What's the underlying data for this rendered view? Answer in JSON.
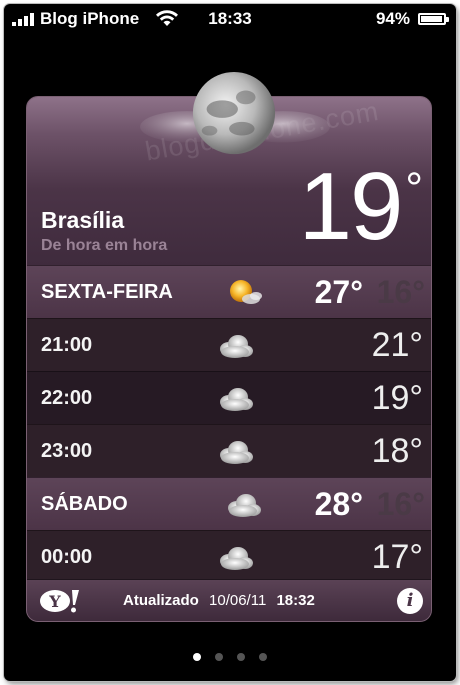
{
  "status_bar": {
    "carrier": "Blog iPhone",
    "time": "18:33",
    "battery": "94%",
    "battery_level": 0.94
  },
  "weather": {
    "watermark": "blogdoiphone.com",
    "city": "Brasília",
    "subtitle": "De hora em hora",
    "current_temp": "19",
    "degree_symbol": "°",
    "rows": [
      {
        "type": "day",
        "label": "SEXTA-FEIRA",
        "icon": "sun-cloud-icon",
        "high": "27°",
        "low": "16°"
      },
      {
        "type": "hour",
        "label": "21:00",
        "icon": "moon-cloud-icon",
        "temp": "21°"
      },
      {
        "type": "hour",
        "label": "22:00",
        "icon": "moon-cloud-icon",
        "temp": "19°"
      },
      {
        "type": "hour",
        "label": "23:00",
        "icon": "moon-cloud-icon",
        "temp": "18°"
      },
      {
        "type": "day",
        "label": "SÁBADO",
        "icon": "moon-cloud-icon",
        "high": "28°",
        "low": "16°"
      },
      {
        "type": "hour",
        "label": "00:00",
        "icon": "moon-cloud-icon",
        "temp": "17°"
      }
    ],
    "footer": {
      "logo": "Y!",
      "updated_label": "Atualizado",
      "updated_date": "10/06/11",
      "updated_time": "18:32",
      "info": "i"
    }
  },
  "pager": {
    "pages": 4,
    "active": 0
  },
  "colors": {
    "card": "#4a3444",
    "accent": "#6a5064"
  }
}
